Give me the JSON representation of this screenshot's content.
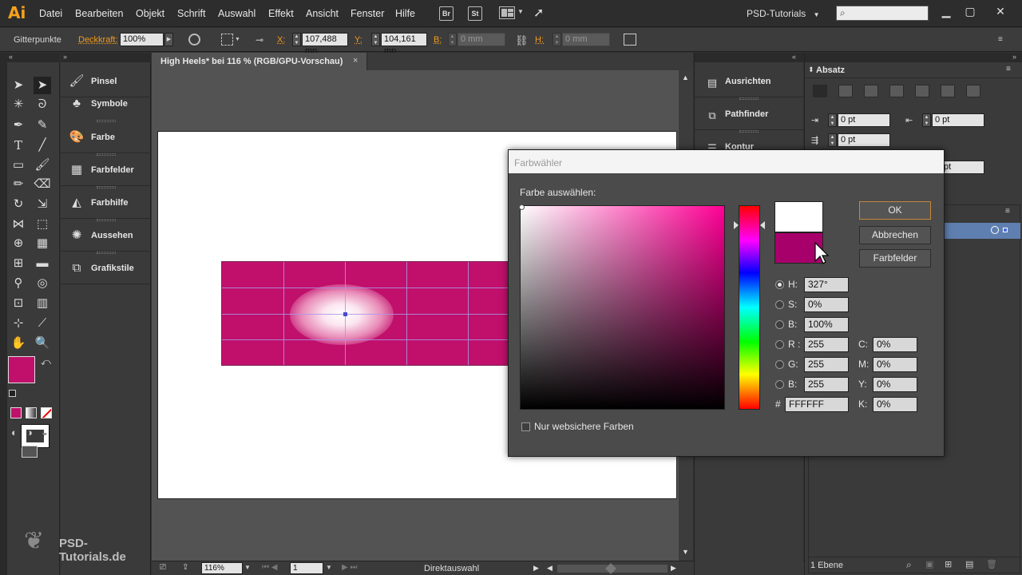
{
  "app": {
    "logo": "Ai"
  },
  "menu": [
    "Datei",
    "Bearbeiten",
    "Objekt",
    "Schrift",
    "Auswahl",
    "Effekt",
    "Ansicht",
    "Fenster",
    "Hilfe"
  ],
  "menu_icons": {
    "br": "Br",
    "st": "St"
  },
  "workspace": "PSD-Tutorials",
  "window_controls": {
    "minimize": "▁",
    "maximize": "▢",
    "close": "✕"
  },
  "control_bar": {
    "selection_label": "Gitterpunkte",
    "opacity_label": "Deckkraft:",
    "opacity_value": "100%",
    "x_label": "X:",
    "x_value": "107,488 mn",
    "y_label": "Y:",
    "y_value": "104,161 mn",
    "b_label": "B:",
    "b_value": "0 mm",
    "h_label": "H:",
    "h_value": "0 mm"
  },
  "left_panels": [
    {
      "icon": "brush-icon",
      "label": "Pinsel"
    },
    {
      "icon": "symbols-icon",
      "label": "Symbole"
    },
    {
      "icon": "palette-icon",
      "label": "Farbe"
    },
    {
      "icon": "swatches-icon",
      "label": "Farbfelder"
    },
    {
      "icon": "color-guide-icon",
      "label": "Farbhilfe"
    },
    {
      "icon": "appearance-icon",
      "label": "Aussehen"
    },
    {
      "icon": "graphic-styles-icon",
      "label": "Grafikstile"
    }
  ],
  "document": {
    "tab_title": "High Heels* bei 116 % (RGB/GPU-Vorschau)",
    "close": "×"
  },
  "status_bar": {
    "zoom": "116%",
    "page": "1",
    "tool": "Direktauswahl"
  },
  "watermark": "PSD-Tutorials.de",
  "right_panels": [
    {
      "icon": "align-icon",
      "label": "Ausrichten"
    },
    {
      "icon": "pathfinder-icon",
      "label": "Pathfinder"
    },
    {
      "icon": "stroke-icon",
      "label": "Kontur"
    }
  ],
  "paragraph_panel": {
    "title": "Absatz",
    "left_indent": "0 pt",
    "right_indent": "0 pt",
    "first_line_indent": "0 pt",
    "space_partial": "pt"
  },
  "layers_panel": {
    "count": "1 Ebene"
  },
  "color_picker": {
    "title": "Farbwähler",
    "select_label": "Farbe auswählen:",
    "buttons": {
      "ok": "OK",
      "cancel": "Abbrechen",
      "swatches": "Farbfelder"
    },
    "h_label": "H:",
    "h_value": "327°",
    "s_label": "S:",
    "s_value": "0%",
    "b_label": "B:",
    "b_value": "100%",
    "r_label": "R :",
    "r_value": "255",
    "g_label": "G:",
    "g_value": "255",
    "bb_label": "B:",
    "bb_value": "255",
    "hex_label": "#",
    "hex_value": "FFFFFF",
    "c_label": "C:",
    "c_value": "0%",
    "m_label": "M:",
    "m_value": "0%",
    "y_label": "Y:",
    "y_value": "0%",
    "k_label": "K:",
    "k_value": "0%",
    "web_only_label": "Nur websichere Farben",
    "new_color": "#ffffff",
    "old_color": "#a8006a"
  },
  "colors": {
    "fill": "#c0106b",
    "accent": "#f29b1d"
  }
}
